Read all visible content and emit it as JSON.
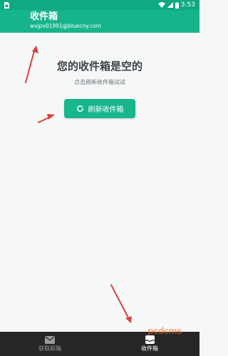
{
  "status_bar": {
    "time": "3:53"
  },
  "app_bar": {
    "title": "收件箱",
    "subtitle": "wvjpv01991@bluecny.com"
  },
  "empty_state": {
    "title": "您的收件箱是空的",
    "hint": "点击刷新收件箱试试"
  },
  "refresh_button": {
    "label": "刷新收件箱"
  },
  "bottom_nav": {
    "items": [
      {
        "label": "获取邮箱",
        "icon": "mail-icon",
        "active": false
      },
      {
        "label": "收件箱",
        "icon": "inbox-icon",
        "active": true
      }
    ]
  },
  "watermark": {
    "text": "pcdcms"
  },
  "colors": {
    "accent": "#16b48a",
    "nav_background": "#262626",
    "annotation_arrow": "#d9443c"
  }
}
